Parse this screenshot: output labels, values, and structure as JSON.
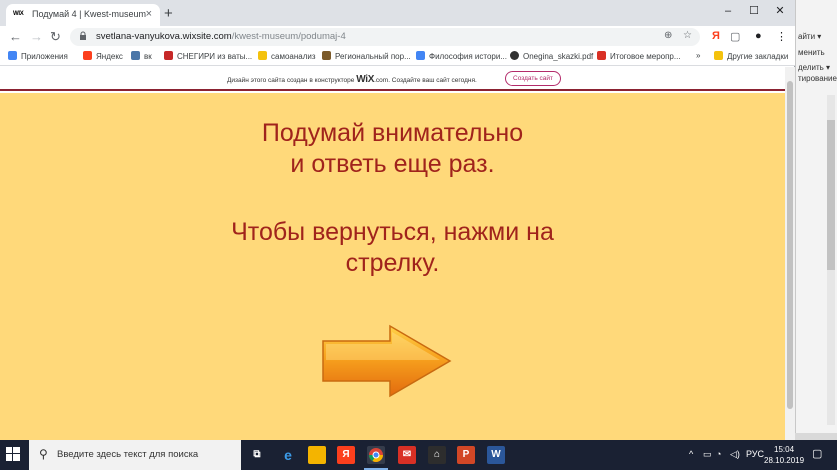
{
  "browser": {
    "tab": {
      "favicon_text": "WIX",
      "title": "Подумай 4 | Kwest-museum",
      "close": "×"
    },
    "new_tab": "+",
    "window_controls": {
      "minimize": "–",
      "maximize": "☐",
      "close": "✕"
    },
    "nav": {
      "back": "←",
      "forward": "→",
      "reload": "↻"
    },
    "url": {
      "host": "svetlana-vanyukova.wixsite.com",
      "path": "/kwest-museum/podumaj-4"
    },
    "bookmarks": [
      {
        "label": "Приложения",
        "icon_color": "#4285f4",
        "icon": "apps-icon"
      },
      {
        "label": "Яндекс",
        "icon_color": "#fc3f1d",
        "icon": "yandex-icon"
      },
      {
        "label": "вк",
        "icon_color": "#4a76a8",
        "icon": "vk-icon"
      },
      {
        "label": "СНЕГИРИ из ваты...",
        "icon_color": "#c62828",
        "icon": "site-icon"
      },
      {
        "label": "самоанализ",
        "icon_color": "#f4c20d",
        "icon": "folder-icon"
      },
      {
        "label": "Региональный пор...",
        "icon_color": "#7b5a2a",
        "icon": "site-icon"
      },
      {
        "label": "Философия истори...",
        "icon_color": "#4285f4",
        "icon": "google-icon"
      },
      {
        "label": "Onegina_skazki.pdf",
        "icon_color": "#333333",
        "icon": "globe-icon"
      },
      {
        "label": "Итоговое меропр...",
        "icon_color": "#d93025",
        "icon": "site-icon"
      }
    ],
    "bookmarks_more": "»",
    "other_bookmarks": "Другие закладки"
  },
  "wix_banner": {
    "text_before": "Дизайн этого сайта создан в конструкторе ",
    "logo": "WiX",
    "text_after": ".com. Создайте ваш сайт сегодня.",
    "button": "Создать сайт"
  },
  "page": {
    "line1": "Подумай внимательно",
    "line2": "и ответь еще раз.",
    "line3": "Чтобы вернуться, нажми на",
    "line4": "стрелку."
  },
  "background_app": {
    "rows": [
      "айти ▾",
      "менить",
      "делить ▾",
      "тирование"
    ]
  },
  "taskbar": {
    "search_placeholder": "Введите здесь текст для поиска",
    "language": "РУС",
    "time": "15:04",
    "date": "28.10.2019"
  },
  "colors": {
    "page_background": "#ffd97a",
    "text": "#a0231c",
    "banner_border": "#8b2232",
    "arrow": "#f28c1a"
  }
}
